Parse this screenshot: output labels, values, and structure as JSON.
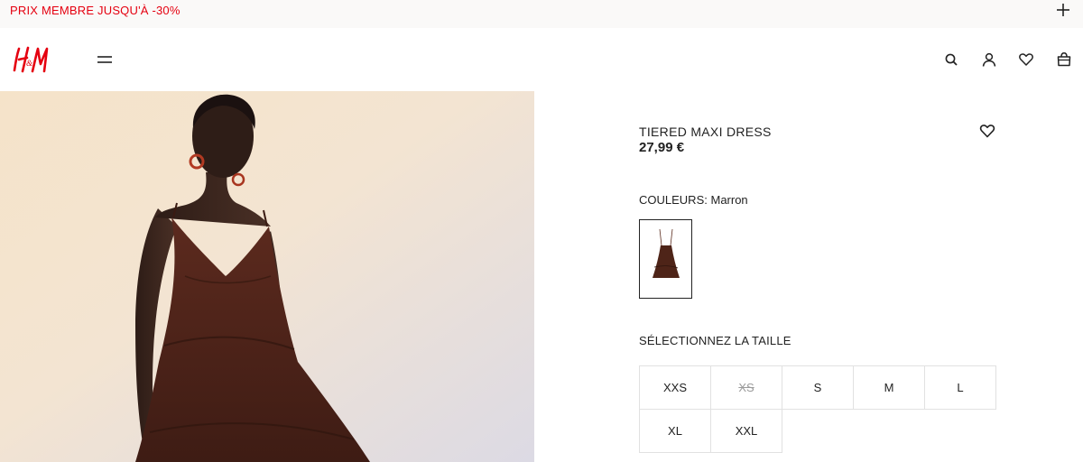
{
  "promo": {
    "text": "PRIX MEMBRE JUSQU'À -30%",
    "expand_icon": "plus-icon",
    "color": "#e50010"
  },
  "header": {
    "logo_text": "H&M",
    "logo_color": "#e50010",
    "menu_icon": "hamburger-menu-icon",
    "icons": [
      "search-icon",
      "account-icon",
      "favorites-icon",
      "shopping-bag-icon"
    ]
  },
  "product": {
    "name": "TIERED MAXI DRESS",
    "price": "27,99 €",
    "favorite_icon": "heart-icon",
    "colour_label": "COULEURS:",
    "colour_value": "Marron",
    "size_heading": "SÉLECTIONNEZ LA TAILLE",
    "sizes": [
      {
        "label": "XXS",
        "available": true
      },
      {
        "label": "XS",
        "available": false
      },
      {
        "label": "S",
        "available": true
      },
      {
        "label": "M",
        "available": true
      },
      {
        "label": "L",
        "available": true
      },
      {
        "label": "XL",
        "available": true
      },
      {
        "label": "XXL",
        "available": true
      }
    ]
  }
}
